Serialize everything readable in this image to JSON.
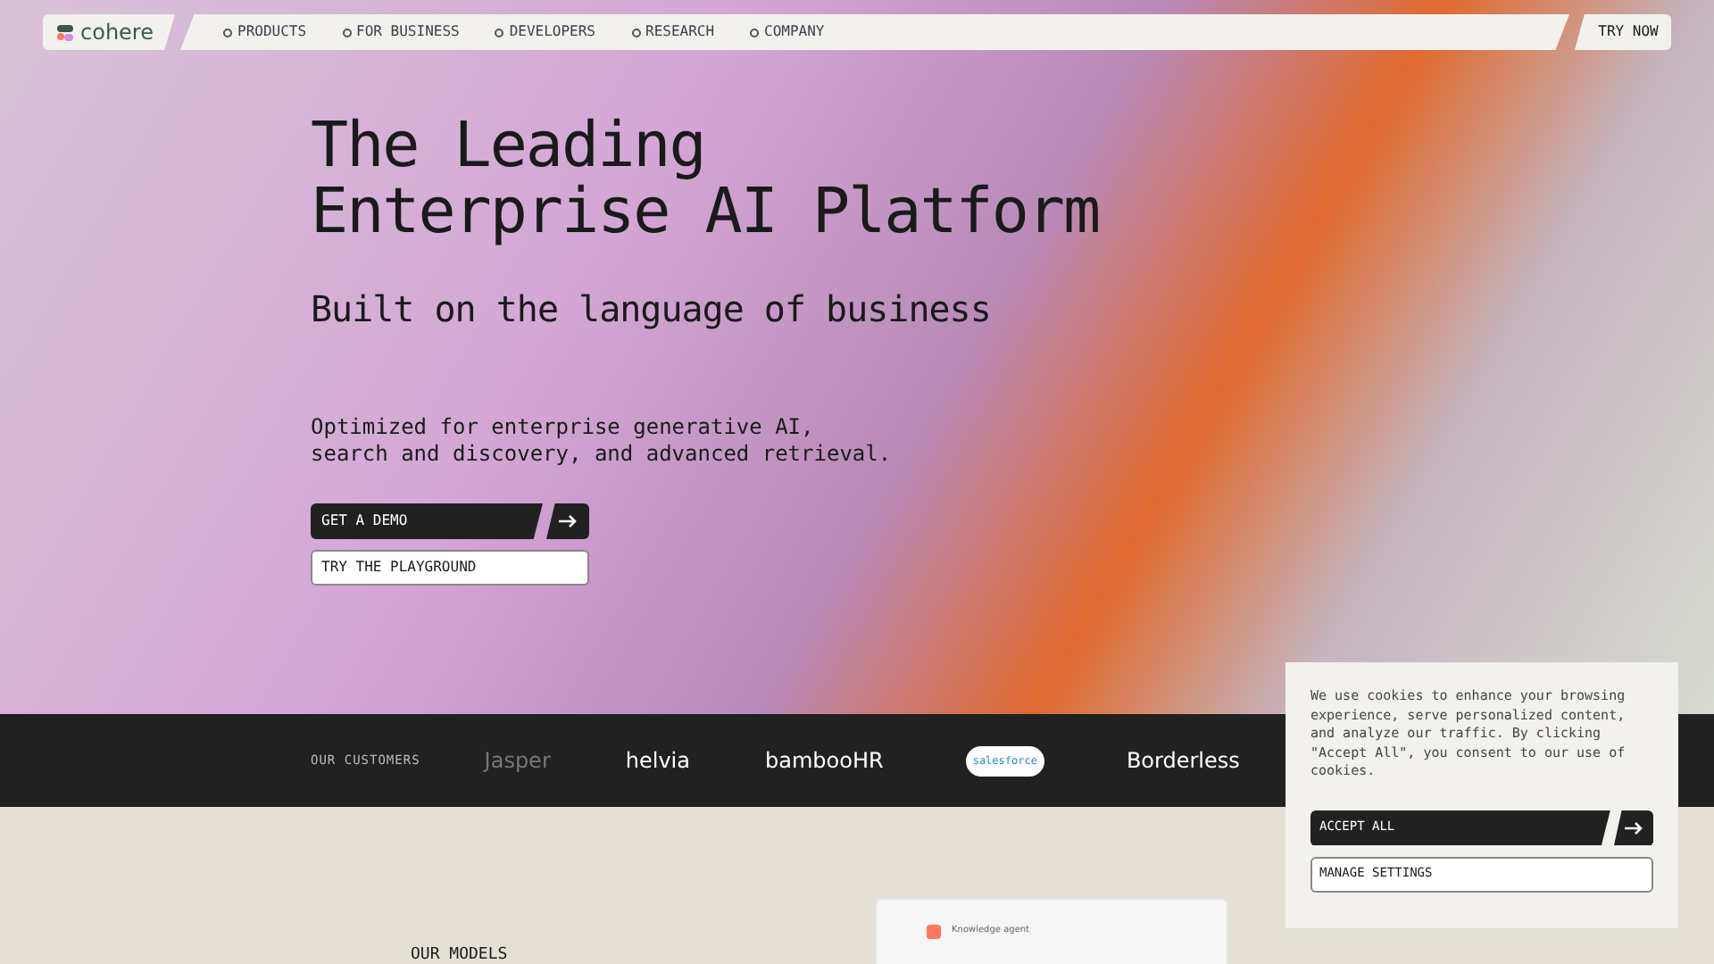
{
  "nav": {
    "logo": "cohere",
    "items": [
      {
        "label": "PRODUCTS"
      },
      {
        "label": "FOR BUSINESS"
      },
      {
        "label": "DEVELOPERS"
      },
      {
        "label": "RESEARCH"
      },
      {
        "label": "COMPANY"
      }
    ],
    "cta": "TRY NOW"
  },
  "hero": {
    "title_lines": [
      "The Leading",
      "Enterprise AI Platform"
    ],
    "subtitle": "Built on the language of business",
    "description_lines": [
      "Optimized for enterprise generative AI,",
      "search and discovery, and advanced retrieval."
    ],
    "primary_button": "GET A DEMO",
    "secondary_button": "TRY THE PLAYGROUND"
  },
  "customers": {
    "label": "OUR CUSTOMERS",
    "logos": [
      "Jasper",
      "helvia",
      "bambooHR",
      "salesforce",
      "Borderless"
    ]
  },
  "models": {
    "label": "OUR MODELS"
  },
  "app_preview": {
    "agent": "Knowledge agent"
  },
  "cookie_banner": {
    "text": "We use cookies to enhance your browsing experience, serve personalized content, and analyze our traffic. By clicking \"Accept All\", you consent to our use of cookies.",
    "accept": "ACCEPT ALL",
    "manage": "MANAGE SETTINGS"
  }
}
